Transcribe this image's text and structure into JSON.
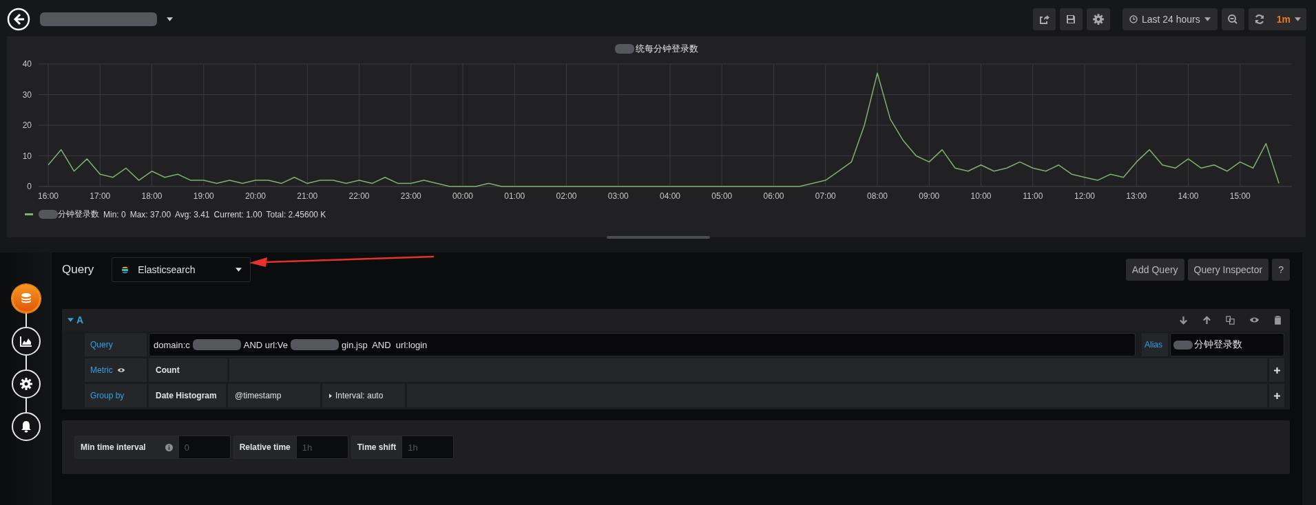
{
  "toolbar": {
    "time_range": "Last 24 hours",
    "refresh_interval": "1m"
  },
  "panel": {
    "title": "统每分钟登录数",
    "chart_data": {
      "type": "line",
      "grid": true,
      "ylim": [
        0,
        40
      ],
      "yticks": [
        0,
        10,
        20,
        30,
        40
      ],
      "categories": [
        "16:00",
        null,
        null,
        null,
        "17:00",
        null,
        null,
        null,
        "18:00",
        null,
        null,
        null,
        "19:00",
        null,
        null,
        null,
        "20:00",
        null,
        null,
        null,
        "21:00",
        null,
        null,
        null,
        "22:00",
        null,
        null,
        null,
        "23:00",
        null,
        null,
        null,
        "00:00",
        null,
        null,
        null,
        "01:00",
        null,
        null,
        null,
        "02:00",
        null,
        null,
        null,
        "03:00",
        null,
        null,
        null,
        "04:00",
        null,
        null,
        null,
        "05:00",
        null,
        null,
        null,
        "06:00",
        null,
        null,
        null,
        "07:00",
        null,
        null,
        null,
        "08:00",
        null,
        null,
        null,
        "09:00",
        null,
        null,
        null,
        "10:00",
        null,
        null,
        null,
        "11:00",
        null,
        null,
        null,
        "12:00",
        null,
        null,
        null,
        "13:00",
        null,
        null,
        null,
        "14:00",
        null,
        null,
        null,
        "15:00",
        null,
        null,
        null
      ],
      "series": [
        {
          "name": "分钟登录数",
          "color": "#7eb26d",
          "values": [
            7,
            12,
            5,
            9,
            4,
            3,
            6,
            2,
            5,
            3,
            4,
            2,
            2,
            1,
            2,
            1,
            2,
            2,
            1,
            3,
            1,
            2,
            2,
            1,
            2,
            1,
            3,
            1,
            1,
            2,
            1,
            0,
            0,
            0,
            1,
            0,
            0,
            0,
            0,
            0,
            0,
            0,
            0,
            0,
            0,
            0,
            0,
            0,
            0,
            0,
            0,
            0,
            0,
            0,
            0,
            0,
            0,
            0,
            0,
            1,
            2,
            5,
            8,
            20,
            37,
            22,
            15,
            10,
            8,
            12,
            6,
            5,
            7,
            5,
            6,
            8,
            6,
            5,
            7,
            4,
            3,
            2,
            4,
            3,
            8,
            12,
            7,
            6,
            9,
            6,
            7,
            5,
            8,
            6,
            14,
            1
          ]
        }
      ]
    },
    "legend": {
      "stats": [
        "Min: 0",
        "Max: 37.00",
        "Avg: 3.41",
        "Current: 1.00",
        "Total: 2.45600 K"
      ]
    }
  },
  "editor": {
    "title": "Query",
    "datasource": "Elasticsearch",
    "buttons": [
      "Add Query",
      "Query Inspector",
      "?"
    ],
    "sidebar": [
      {
        "kind": "queries",
        "selected": true
      },
      {
        "kind": "visualization",
        "selected": false
      },
      {
        "kind": "general",
        "selected": false
      },
      {
        "kind": "alert",
        "selected": false
      }
    ]
  },
  "query_a": {
    "ref": "A",
    "expanded": true,
    "query_label": "Query",
    "query_parts": [
      "domain:c",
      "AND url:Ve",
      "gin.jsp  AND  url:login"
    ],
    "alias_label": "Alias",
    "alias_text": "分钟登录数",
    "metric_label": "Metric",
    "metric_type": "Count",
    "group_by_label": "Group by",
    "group_by_type": "Date Histogram",
    "group_by_field": "@timestamp",
    "interval": "Interval: auto"
  },
  "options": [
    {
      "label": "Min time interval",
      "info": true,
      "placeholder": "0"
    },
    {
      "label": "Relative time",
      "info": false,
      "placeholder": "1h"
    },
    {
      "label": "Time shift",
      "info": false,
      "placeholder": "1h"
    }
  ]
}
